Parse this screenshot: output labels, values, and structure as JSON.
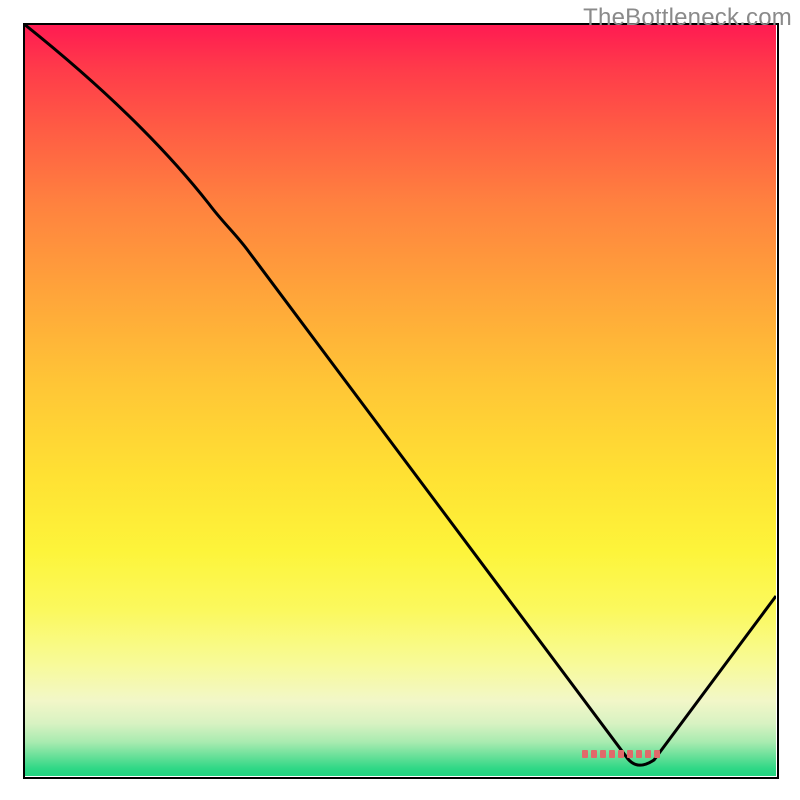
{
  "watermark": "TheBottleneck.com",
  "chart_data": {
    "type": "line",
    "title": "",
    "xlabel": "",
    "ylabel": "",
    "xlim": [
      0,
      100
    ],
    "ylim": [
      0,
      100
    ],
    "grid": false,
    "series": [
      {
        "name": "curve",
        "x": [
          0,
          10,
          20,
          25,
          30,
          40,
          50,
          60,
          70,
          78,
          82,
          86,
          90,
          95,
          100
        ],
        "values": [
          100,
          92,
          82,
          75,
          67,
          54,
          40,
          27,
          13,
          3,
          1,
          4,
          10,
          17,
          24
        ]
      }
    ],
    "markers": [
      {
        "name": "optimal-range",
        "x_start": 74,
        "x_end": 84,
        "y": 2
      }
    ],
    "background_gradient": {
      "top": "#ff1a52",
      "mid": "#ffe133",
      "bottom": "#22d481"
    }
  }
}
